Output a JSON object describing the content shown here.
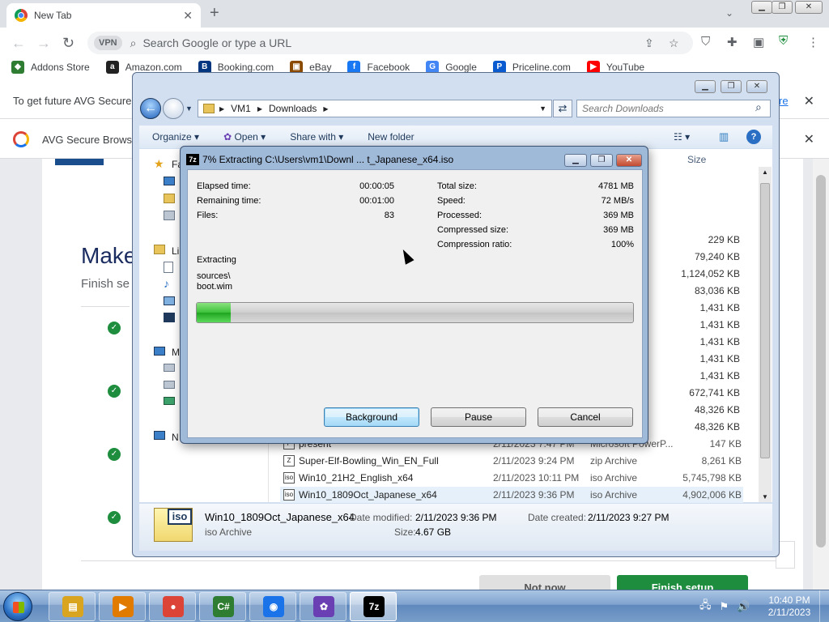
{
  "chrome": {
    "tab_title": "New Tab",
    "tab_close": "✕",
    "new_tab": "+",
    "omnibox_placeholder": "Search Google or type a URL",
    "vpn_label": "VPN",
    "bookmarks": [
      {
        "label": "Addons Store",
        "icon": "addons-store-icon",
        "color": "#2e7d32",
        "glyph": "◆"
      },
      {
        "label": "Amazon.com",
        "icon": "amazon-icon",
        "color": "#222222",
        "glyph": "a"
      },
      {
        "label": "Booking.com",
        "icon": "booking-icon",
        "color": "#003580",
        "glyph": "B"
      },
      {
        "label": "eBay",
        "icon": "ebay-icon",
        "color": "#8a4b00",
        "glyph": "▣"
      },
      {
        "label": "Facebook",
        "icon": "facebook-icon",
        "color": "#1877f2",
        "glyph": "f"
      },
      {
        "label": "Google",
        "icon": "google-icon",
        "color": "#4285f4",
        "glyph": "G"
      },
      {
        "label": "Priceline.com",
        "icon": "priceline-icon",
        "color": "#0a5ad0",
        "glyph": "P"
      },
      {
        "label": "YouTube",
        "icon": "youtube-icon",
        "color": "#ff0000",
        "glyph": "▶"
      }
    ],
    "infobar1_text": "To get future AVG Secure",
    "infobar1_link": "re",
    "infobar2_text": "AVG Secure Browse",
    "close_glyph": "✕"
  },
  "page": {
    "heading": "Make",
    "subheading": "Finish se",
    "not_now": "Not now",
    "finish_setup": "Finish setup"
  },
  "explorer": {
    "breadcrumb": [
      "VM1",
      "Downloads"
    ],
    "search_placeholder": "Search Downloads",
    "commands": [
      "Organize",
      "Open",
      "Share with",
      "New folder"
    ],
    "nav_letters": [
      "Fa",
      "Li",
      "M",
      "N"
    ],
    "size_header": "Size",
    "sizes": [
      "229 KB",
      "79,240 KB",
      "1,124,052 KB",
      "83,036 KB",
      "1,431 KB",
      "1,431 KB",
      "1,431 KB",
      "1,431 KB",
      "1,431 KB",
      "672,741 KB",
      "48,326 KB",
      "48,326 KB"
    ],
    "files": [
      {
        "name": "present",
        "date": "2/11/2023 7:47 PM",
        "type": "Microsoft PowerP...",
        "size": "147 KB",
        "icon": "ppt-file-icon",
        "selected": false
      },
      {
        "name": "Super-Elf-Bowling_Win_EN_Full",
        "date": "2/11/2023 9:24 PM",
        "type": "zip Archive",
        "size": "8,261 KB",
        "icon": "zip-file-icon",
        "selected": false
      },
      {
        "name": "Win10_21H2_English_x64",
        "date": "2/11/2023 10:11 PM",
        "type": "iso Archive",
        "size": "5,745,798 KB",
        "icon": "iso-file-icon",
        "selected": false
      },
      {
        "name": "Win10_1809Oct_Japanese_x64",
        "date": "2/11/2023 9:36 PM",
        "type": "iso Archive",
        "size": "4,902,006 KB",
        "icon": "iso-file-icon",
        "selected": true
      }
    ],
    "details": {
      "name": "Win10_1809Oct_Japanese_x64",
      "type": "iso Archive",
      "date_modified_label": "Date modified:",
      "date_modified": "2/11/2023 9:36 PM",
      "size_label": "Size:",
      "size": "4.67 GB",
      "date_created_label": "Date created:",
      "date_created": "2/11/2023 9:27 PM",
      "badge": "iso"
    }
  },
  "dialog": {
    "title": "7% Extracting C:\\Users\\vm1\\Downl ... t_Japanese_x64.iso",
    "app_badge": "7z",
    "left_stats": [
      {
        "label": "Elapsed time:",
        "value": "00:00:05"
      },
      {
        "label": "Remaining time:",
        "value": "00:01:00"
      },
      {
        "label": "Files:",
        "value": "83"
      }
    ],
    "right_stats": [
      {
        "label": "Total size:",
        "value": "4781 MB"
      },
      {
        "label": "Speed:",
        "value": "72 MB/s"
      },
      {
        "label": "Processed:",
        "value": "369 MB"
      },
      {
        "label": "Compressed size:",
        "value": "369 MB"
      },
      {
        "label": "Compression ratio:",
        "value": "100%"
      }
    ],
    "status_label": "Extracting",
    "current_path": "sources\\",
    "current_file": "boot.wim",
    "progress_fraction": 0.077,
    "buttons": {
      "background": "Background",
      "pause": "Pause",
      "cancel": "Cancel"
    }
  },
  "taskbar": {
    "time": "10:40 PM",
    "date": "2/11/2023",
    "items": [
      {
        "icon": "file-explorer-icon",
        "color": "#d9a520",
        "glyph": "▤",
        "active": false
      },
      {
        "icon": "media-player-icon",
        "color": "#e07b00",
        "glyph": "▶",
        "active": false
      },
      {
        "icon": "chrome-icon",
        "color": "#db4437",
        "glyph": "●",
        "active": false
      },
      {
        "icon": "csharp-icon",
        "color": "#2e7d32",
        "glyph": "C#",
        "active": false
      },
      {
        "icon": "avg-browser-icon",
        "color": "#1a73e8",
        "glyph": "◉",
        "active": false
      },
      {
        "icon": "app-icon",
        "color": "#6a3fb3",
        "glyph": "✿",
        "active": false
      },
      {
        "icon": "7zip-icon",
        "color": "#000000",
        "glyph": "7z",
        "active": true
      }
    ]
  }
}
